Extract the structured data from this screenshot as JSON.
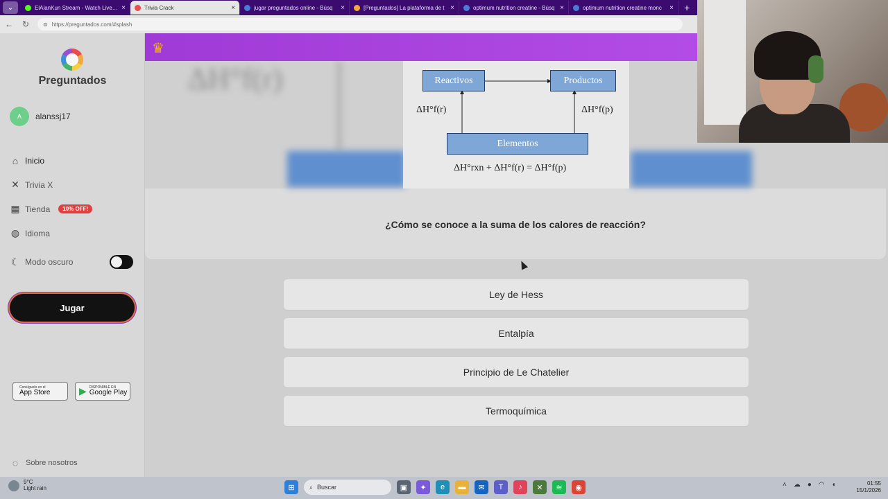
{
  "browser": {
    "tabs": [
      {
        "title": "ElAlanKun Stream - Watch Live on",
        "active": false,
        "color": "#53fc18"
      },
      {
        "title": "Trivia Crack",
        "active": true,
        "color": "#e84c4c"
      },
      {
        "title": "jugar preguntados online - Búsq",
        "active": false,
        "color": "#4a7bd8"
      },
      {
        "title": "[Preguntados] La plataforma de t",
        "active": false,
        "color": "#f2a93b"
      },
      {
        "title": "optimum nutrition creatine - Búsq",
        "active": false,
        "color": "#4a7bd8"
      },
      {
        "title": "optimum nutrition creatine monc",
        "active": false,
        "color": "#4a7bd8"
      }
    ],
    "url": "https://preguntados.com/#splash"
  },
  "sidebar": {
    "brand": "Preguntados",
    "user": {
      "initial": "A",
      "name": "alanssj17"
    },
    "nav": [
      {
        "label": "Inicio",
        "icon": "home-icon"
      },
      {
        "label": "Trivia X",
        "icon": "trivia-x-icon"
      },
      {
        "label": "Tienda",
        "icon": "store-icon",
        "badge": "10% OFF!"
      },
      {
        "label": "Idioma",
        "icon": "globe-icon"
      }
    ],
    "dark_mode_label": "Modo oscuro",
    "play_button": "Jugar",
    "app_store": {
      "small": "Consíguelo en el",
      "big": "App Store"
    },
    "google_play": {
      "small": "DISPONIBLE EN",
      "big": "Google Play"
    },
    "about": "Sobre nosotros"
  },
  "diagram": {
    "reactivos": "Reactivos",
    "productos": "Productos",
    "elementos": "Elementos",
    "left_label": "ΔH°f(r)",
    "right_label": "ΔH°f(p)",
    "equation": "ΔH°rxn + ΔH°f(r) = ΔH°f(p)",
    "blur_text": "ΔH°f(r)"
  },
  "question": "¿Cómo se conoce a la suma de los calores de reacción?",
  "answers": [
    "Ley de Hess",
    "Entalpía",
    "Principio de Le Chatelier",
    "Termoquímica"
  ],
  "taskbar": {
    "weather_temp": "9°C",
    "weather_desc": "Light rain",
    "search": "Buscar",
    "time": "01:55",
    "date": "15/1/2026"
  }
}
